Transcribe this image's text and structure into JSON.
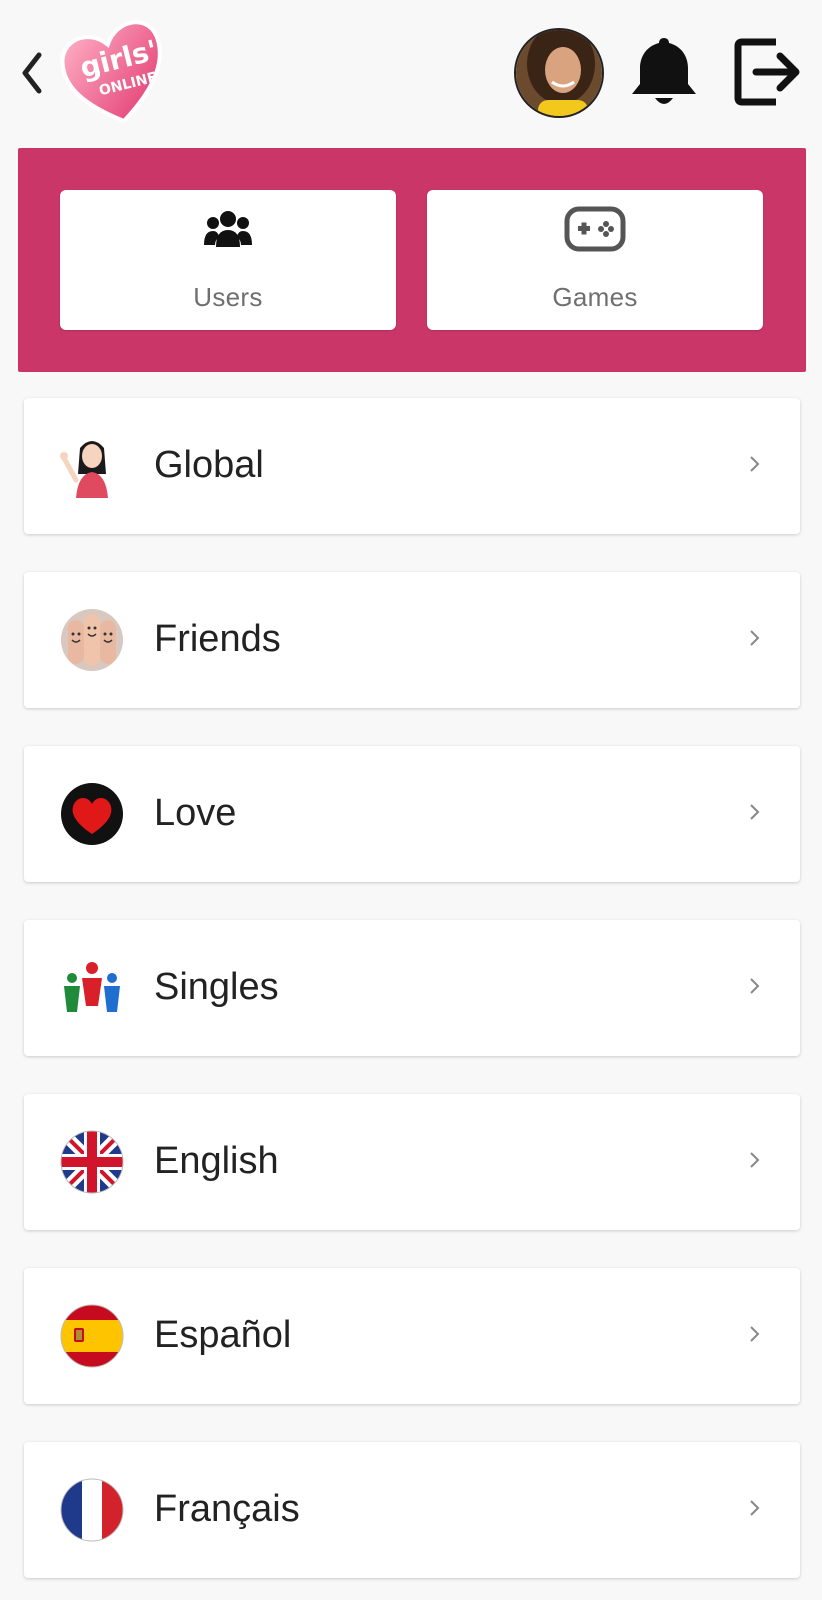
{
  "header": {
    "logo_text_top": "girls'",
    "logo_text_bottom": "ONLINE",
    "back_icon": "chevron-left-icon",
    "notification_icon": "bell-icon",
    "logout_icon": "logout-icon"
  },
  "tabs": [
    {
      "label": "Users",
      "icon": "users-icon"
    },
    {
      "label": "Games",
      "icon": "gamepad-icon"
    }
  ],
  "rooms": [
    {
      "label": "Global",
      "icon": "waving-girl-icon"
    },
    {
      "label": "Friends",
      "icon": "finger-faces-icon"
    },
    {
      "label": "Love",
      "icon": "heart-icon"
    },
    {
      "label": "Singles",
      "icon": "people-group-icon"
    },
    {
      "label": "English",
      "icon": "uk-flag-icon"
    },
    {
      "label": "Español",
      "icon": "spain-flag-icon"
    },
    {
      "label": "Français",
      "icon": "france-flag-icon"
    }
  ],
  "colors": {
    "accent": "#cb3669",
    "background": "#f8f8f8",
    "card": "#ffffff",
    "tab_label": "#6f6f6f"
  }
}
